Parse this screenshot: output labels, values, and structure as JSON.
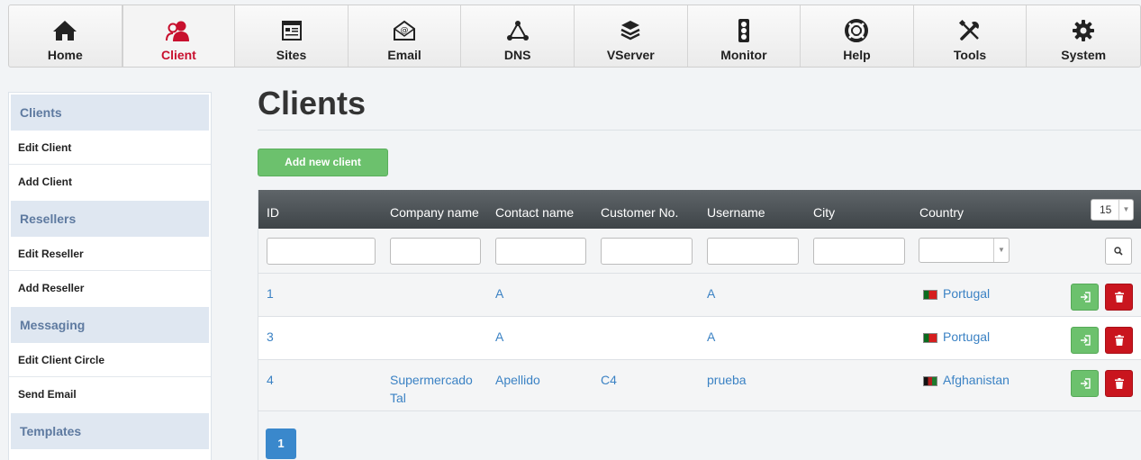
{
  "nav": {
    "items": [
      {
        "label": "Home",
        "icon": "home-icon"
      },
      {
        "label": "Client",
        "icon": "client-icon"
      },
      {
        "label": "Sites",
        "icon": "sites-icon"
      },
      {
        "label": "Email",
        "icon": "email-icon"
      },
      {
        "label": "DNS",
        "icon": "dns-icon"
      },
      {
        "label": "VServer",
        "icon": "vserver-icon"
      },
      {
        "label": "Monitor",
        "icon": "monitor-icon"
      },
      {
        "label": "Help",
        "icon": "help-icon"
      },
      {
        "label": "Tools",
        "icon": "tools-icon"
      },
      {
        "label": "System",
        "icon": "system-icon"
      }
    ],
    "active": "Client"
  },
  "sidebar": {
    "sections": [
      {
        "heading": "Clients",
        "items": [
          "Edit Client",
          "Add Client"
        ]
      },
      {
        "heading": "Resellers",
        "items": [
          "Edit Reseller",
          "Add Reseller"
        ]
      },
      {
        "heading": "Messaging",
        "items": [
          "Edit Client Circle",
          "Send Email"
        ]
      },
      {
        "heading": "Templates",
        "items": []
      }
    ]
  },
  "main": {
    "title": "Clients",
    "add_button": "Add new client",
    "columns": [
      "ID",
      "Company name",
      "Contact name",
      "Customer No.",
      "Username",
      "City",
      "Country"
    ],
    "rows_per_page": "15",
    "rows": [
      {
        "id": "1",
        "company": "",
        "contact": "A",
        "customer_no": "",
        "username": "A",
        "city": "",
        "country": "Portugal",
        "flag": "pt"
      },
      {
        "id": "3",
        "company": "",
        "contact": "A",
        "customer_no": "",
        "username": "A",
        "city": "",
        "country": "Portugal",
        "flag": "pt"
      },
      {
        "id": "4",
        "company": "Supermercado Tal",
        "contact": "Apellido",
        "customer_no": "C4",
        "username": "prueba",
        "city": "",
        "country": "Afghanistan",
        "flag": "af"
      }
    ],
    "current_page": "1"
  },
  "colors": {
    "accent_red": "#c8102e",
    "link_blue": "#3b82c4",
    "success_green": "#6cc16d",
    "danger_red": "#c9151e",
    "header_dark": "#4a5054",
    "page_blue": "#3a88cc"
  }
}
